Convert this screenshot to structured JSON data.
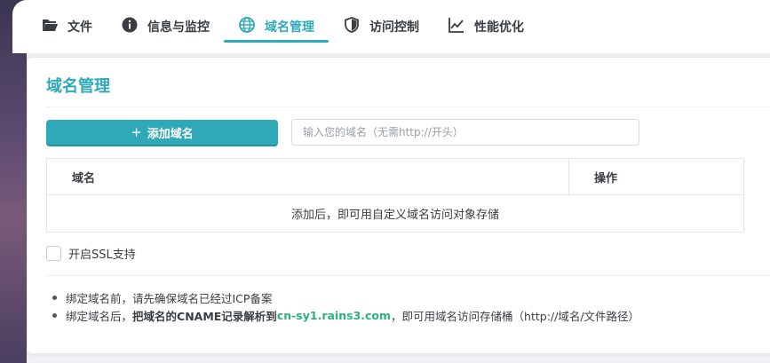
{
  "tabs": [
    {
      "label": "文件",
      "icon": "folder-open-icon",
      "active": false
    },
    {
      "label": "信息与监控",
      "icon": "info-circle-icon",
      "active": false
    },
    {
      "label": "域名管理",
      "icon": "globe-icon",
      "active": true
    },
    {
      "label": "访问控制",
      "icon": "shield-icon",
      "active": false
    },
    {
      "label": "性能优化",
      "icon": "line-chart-icon",
      "active": false
    }
  ],
  "card": {
    "title": "域名管理",
    "add_button_label": "添加域名",
    "add_button_icon": "plus-icon",
    "input_placeholder": "输入您的域名（无需http://开头）",
    "input_value": ""
  },
  "table": {
    "columns": [
      "域名",
      "操作"
    ],
    "empty_text": "添加后，即可用自定义域名访问对象存储"
  },
  "ssl": {
    "label": "开启SSL支持",
    "checked": false
  },
  "notes": {
    "note1": "绑定域名前，请先确保域名已经过ICP备案",
    "note2_prefix": "绑定域名后，",
    "note2_bold": "把域名的CNAME记录解析到",
    "note2_endpoint": "cn-sy1.rains3.com",
    "note2_suffix": "，即可用域名访问存储桶（http://域名/文件路径）"
  },
  "colors": {
    "accent": "#2fa9b7",
    "endpoint": "#2bb37b",
    "text": "#3a3d44"
  }
}
